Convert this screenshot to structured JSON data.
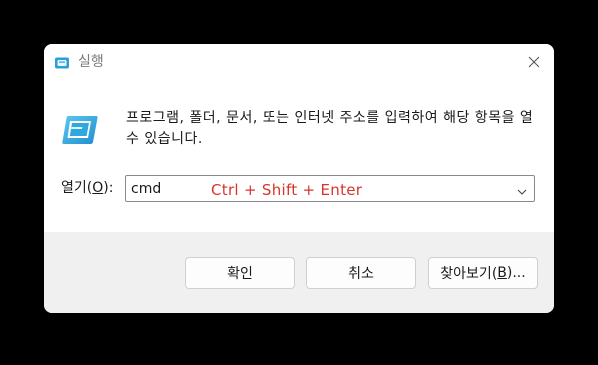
{
  "window": {
    "title": "실행",
    "close_icon": "close-icon"
  },
  "content": {
    "description": "프로그램, 폴더, 문서, 또는 인터넷 주소를 입력하여 해당 항목을 열 수 있습니다.",
    "run_icon": "run-icon"
  },
  "open": {
    "label_prefix": "열기(",
    "label_hotkey": "O",
    "label_suffix": "):",
    "value": "cmd",
    "overlay_text": "Ctrl + Shift + Enter",
    "overlay_color": "#d9342b"
  },
  "buttons": {
    "ok": "확인",
    "cancel": "취소",
    "browse_prefix": "찾아보기(",
    "browse_hotkey": "B",
    "browse_suffix": ")..."
  }
}
